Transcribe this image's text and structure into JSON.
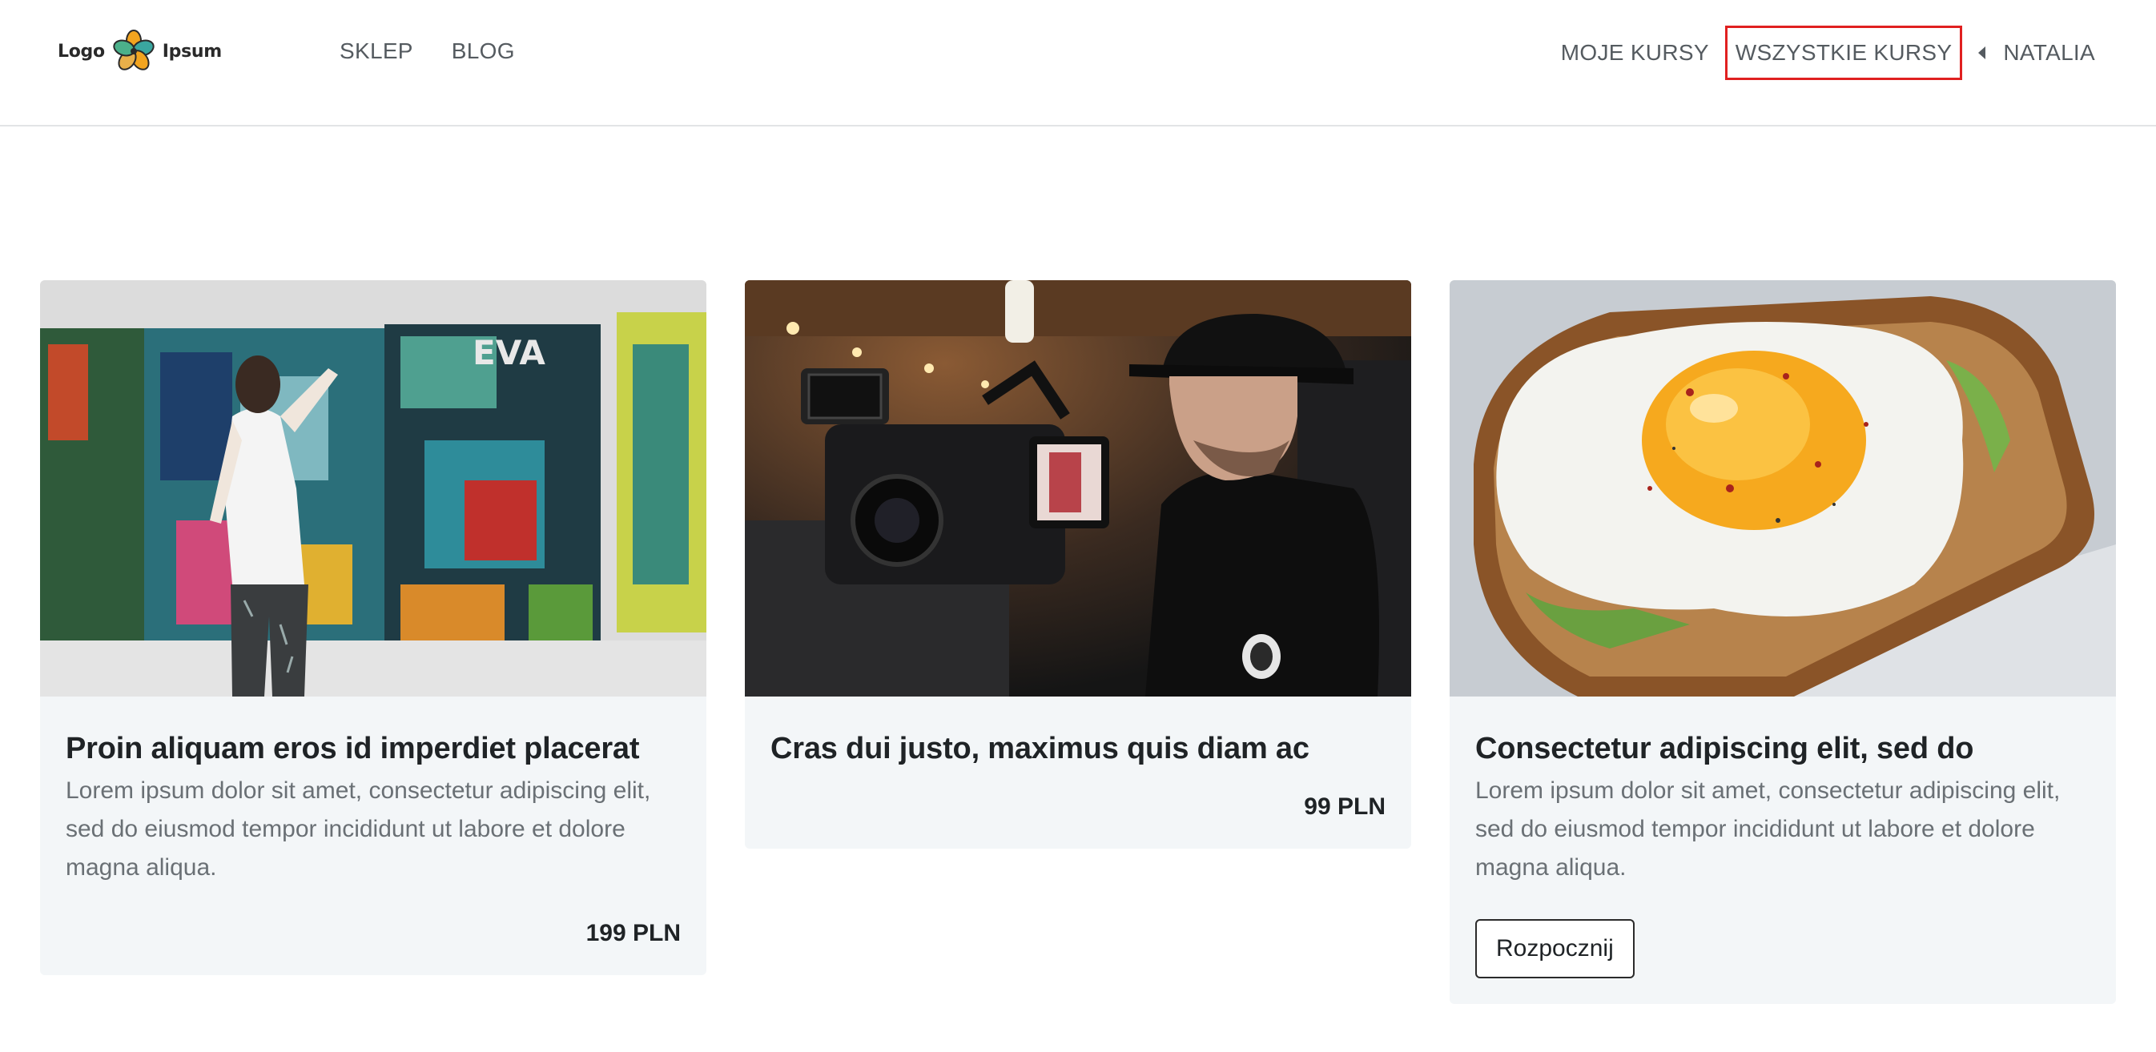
{
  "header": {
    "logo": {
      "left_text": "Logo",
      "right_text": "Ipsum"
    },
    "nav_left": [
      {
        "label": "SKLEP"
      },
      {
        "label": "BLOG"
      }
    ],
    "nav_right": {
      "my_courses": "MOJE KURSY",
      "all_courses": "WSZYSTKIE KURSY",
      "user_name": "NATALIA"
    }
  },
  "colors": {
    "highlight_border": "#e02020",
    "card_background": "#f3f6f8",
    "nav_text": "#555b60"
  },
  "cards": [
    {
      "image": "artist-painting-graffiti-wall",
      "title": "Proin aliquam eros id imperdiet placerat",
      "description": "Lorem ipsum dolor sit amet, consectetur adipiscing elit, sed do eiusmod tempor incididunt ut labore et dolore magna aliqua.",
      "price": "199 PLN"
    },
    {
      "image": "man-with-video-camera",
      "title": "Cras dui justo, maximus quis diam ac",
      "price": "99 PLN"
    },
    {
      "image": "fried-egg-on-toast",
      "title": "Consectetur adipiscing elit, sed do",
      "description": "Lorem ipsum dolor sit amet, consectetur adipiscing elit, sed do eiusmod tempor incididunt ut labore et dolore magna aliqua.",
      "button_label": "Rozpocznij"
    }
  ]
}
